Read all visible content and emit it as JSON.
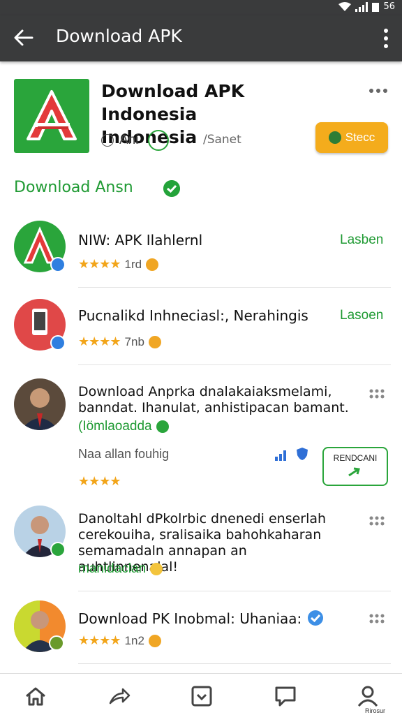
{
  "status_bar": {
    "battery_text": "56"
  },
  "app_bar": {
    "title": "Download APK"
  },
  "hero": {
    "title_line1": "Download APK Indonesia",
    "title_line2": "Indonesia",
    "subtitle": "/Sanet",
    "meta_label": "Ani",
    "button_label": "Stecc"
  },
  "section": {
    "title": "Download Ansn"
  },
  "items": [
    {
      "title": "NIW: APK Ilahlernl",
      "rating_text": "1rd",
      "action": "Lasben"
    },
    {
      "title": "Pucnalikd Inhneciasl:, Nerahingis",
      "rating_text": "7nb",
      "action": "Lasoen"
    },
    {
      "line1": "Download Anprka dnalakaiaksmelami,",
      "line2": "banndat. Ihanulat, anhistipacan bamant.",
      "line3": "(Iömlaoadda",
      "gray_label": "Naa allan  fouhig",
      "button_label": "RENDCANI"
    },
    {
      "line1": "Danoltahl dPkolrbic dnenedi enserlah",
      "line2": "cerekouiha, sralisaika bahohkaharan",
      "line3": "semamadaln annapan an auhtlinnenalal!",
      "line4": "manidaclan"
    },
    {
      "title": "Download PK Inobmal: Uhaniaa:",
      "rating_text": "1n2"
    }
  ],
  "bottom_nav": {
    "profile_label": "Rirosur"
  },
  "colors": {
    "accent_green": "#1f9a33",
    "appbar": "#3a3b3c",
    "select_orange": "#f4ac1c",
    "star": "#f2a51a"
  }
}
